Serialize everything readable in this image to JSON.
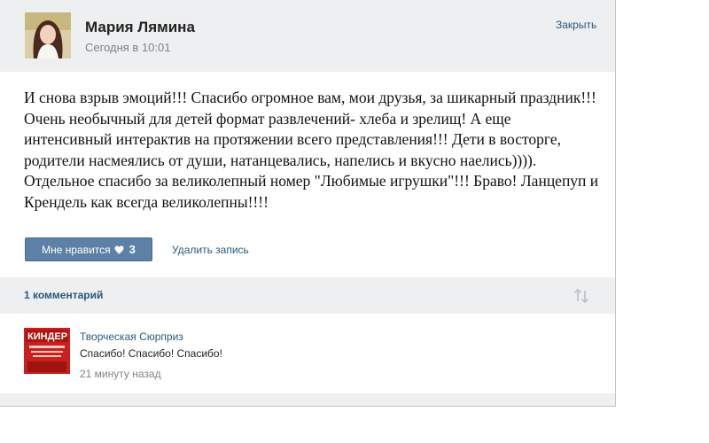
{
  "post": {
    "author": "Мария Лямина",
    "date": "Сегодня в 10:01",
    "close_label": "Закрыть",
    "text": "И снова взрыв эмоций!!! Спасибо огромное вам, мои друзья, за шикарный праздник!!! Очень необычный для детей формат развлечений- хлеба и зрелищ! А еще интенсивный интерактив на протяжении всего представления!!! Дети в восторге, родители насмеялись от души, натанцевались, напелись и вкусно наелись)))). Отдельное спасибо за великолепный номер \"Любимые игрушки\"!!! Браво! Ланцепуп и Крендель как всегда великолепны!!!!",
    "like_label": "Мне нравится",
    "like_count": "3",
    "delete_label": "Удалить запись"
  },
  "comments": {
    "count_label": "1 комментарий",
    "items": [
      {
        "author": "Творческая Сюрприз",
        "text": "Спасибо! Спасибо! Спасибо!",
        "time": "21 минуту назад",
        "avatar_logo": "КИНДЕР"
      }
    ]
  },
  "colors": {
    "link": "#2b587a",
    "button": "#5d80a6",
    "bar": "#eeeff1"
  },
  "icons": {
    "like": "heart-icon",
    "sort": "sort-arrows-icon"
  }
}
